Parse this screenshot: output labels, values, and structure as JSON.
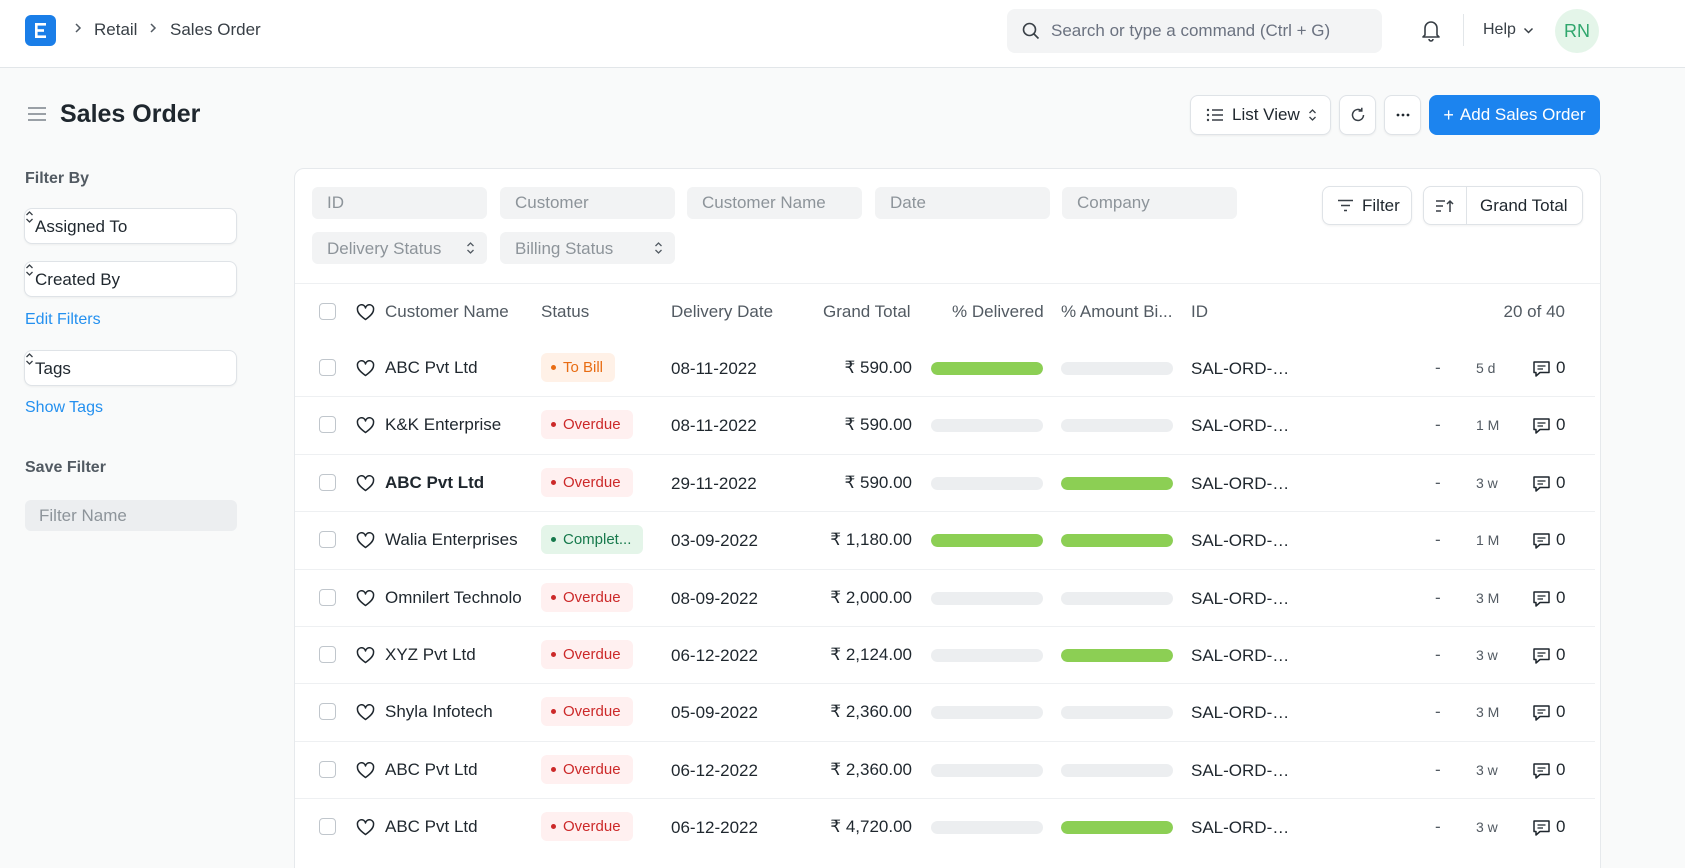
{
  "brand": {
    "logo_letter": "E",
    "accent": "#1c84ef"
  },
  "breadcrumb": [
    "Retail",
    "Sales Order"
  ],
  "search": {
    "placeholder": "Search or type a command (Ctrl + G)"
  },
  "navbar": {
    "help_label": "Help",
    "avatar_initials": "RN"
  },
  "page": {
    "title": "Sales Order",
    "list_view_label": "List View",
    "more_label": "···",
    "add_label": "Add Sales Order"
  },
  "sidebar": {
    "filter_by": "Filter By",
    "assigned_to": "Assigned To",
    "created_by": "Created By",
    "edit_filters": "Edit Filters",
    "tags": "Tags",
    "show_tags": "Show Tags",
    "save_filter": "Save Filter",
    "filter_name_placeholder": "Filter Name"
  },
  "filters": {
    "id": "ID",
    "customer": "Customer",
    "customer_name": "Customer Name",
    "date": "Date",
    "company": "Company",
    "delivery_status": "Delivery Status",
    "billing_status": "Billing Status",
    "filter_button": "Filter",
    "sort_label": "Grand Total"
  },
  "table": {
    "columns": {
      "customer_name": "Customer Name",
      "status": "Status",
      "delivery_date": "Delivery Date",
      "grand_total": "Grand Total",
      "delivered": "% Delivered",
      "amount_billed": "% Amount Bi...",
      "id": "ID"
    },
    "count": "20 of 40",
    "rows": [
      {
        "customer": "ABC Pvt Ltd",
        "status": "To Bill",
        "status_color": "orange",
        "date": "08-11-2022",
        "total": "₹ 590.00",
        "delivered": 100,
        "billed": 0,
        "id": "SAL-ORD-2...",
        "dash": "-",
        "ago": "5 d",
        "comments": "0",
        "bold": false
      },
      {
        "customer": "K&K Enterprise",
        "status": "Overdue",
        "status_color": "red",
        "date": "08-11-2022",
        "total": "₹ 590.00",
        "delivered": 0,
        "billed": 0,
        "id": "SAL-ORD-2...",
        "dash": "-",
        "ago": "1 M",
        "comments": "0",
        "bold": false
      },
      {
        "customer": "ABC Pvt Ltd",
        "status": "Overdue",
        "status_color": "red",
        "date": "29-11-2022",
        "total": "₹ 590.00",
        "delivered": 0,
        "billed": 100,
        "id": "SAL-ORD-2...",
        "dash": "-",
        "ago": "3 w",
        "comments": "0",
        "bold": true
      },
      {
        "customer": "Walia Enterprises",
        "status": "Complet...",
        "status_color": "green",
        "date": "03-09-2022",
        "total": "₹ 1,180.00",
        "delivered": 100,
        "billed": 100,
        "id": "SAL-ORD-2...",
        "dash": "-",
        "ago": "1 M",
        "comments": "0",
        "bold": false
      },
      {
        "customer": "Omnilert Technolo",
        "status": "Overdue",
        "status_color": "red",
        "date": "08-09-2022",
        "total": "₹ 2,000.00",
        "delivered": 0,
        "billed": 0,
        "id": "SAL-ORD-2...",
        "dash": "-",
        "ago": "3 M",
        "comments": "0",
        "bold": false
      },
      {
        "customer": "XYZ Pvt Ltd",
        "status": "Overdue",
        "status_color": "red",
        "date": "06-12-2022",
        "total": "₹ 2,124.00",
        "delivered": 0,
        "billed": 100,
        "id": "SAL-ORD-2...",
        "dash": "-",
        "ago": "3 w",
        "comments": "0",
        "bold": false
      },
      {
        "customer": "Shyla Infotech",
        "status": "Overdue",
        "status_color": "red",
        "date": "05-09-2022",
        "total": "₹ 2,360.00",
        "delivered": 0,
        "billed": 0,
        "id": "SAL-ORD-2...",
        "dash": "-",
        "ago": "3 M",
        "comments": "0",
        "bold": false
      },
      {
        "customer": "ABC Pvt Ltd",
        "status": "Overdue",
        "status_color": "red",
        "date": "06-12-2022",
        "total": "₹ 2,360.00",
        "delivered": 0,
        "billed": 0,
        "id": "SAL-ORD-2...",
        "dash": "-",
        "ago": "3 w",
        "comments": "0",
        "bold": false
      },
      {
        "customer": "ABC Pvt Ltd",
        "status": "Overdue",
        "status_color": "red",
        "date": "06-12-2022",
        "total": "₹ 4,720.00",
        "delivered": 0,
        "billed": 100,
        "id": "SAL-ORD-2...",
        "dash": "-",
        "ago": "3 w",
        "comments": "0",
        "bold": false
      }
    ]
  }
}
